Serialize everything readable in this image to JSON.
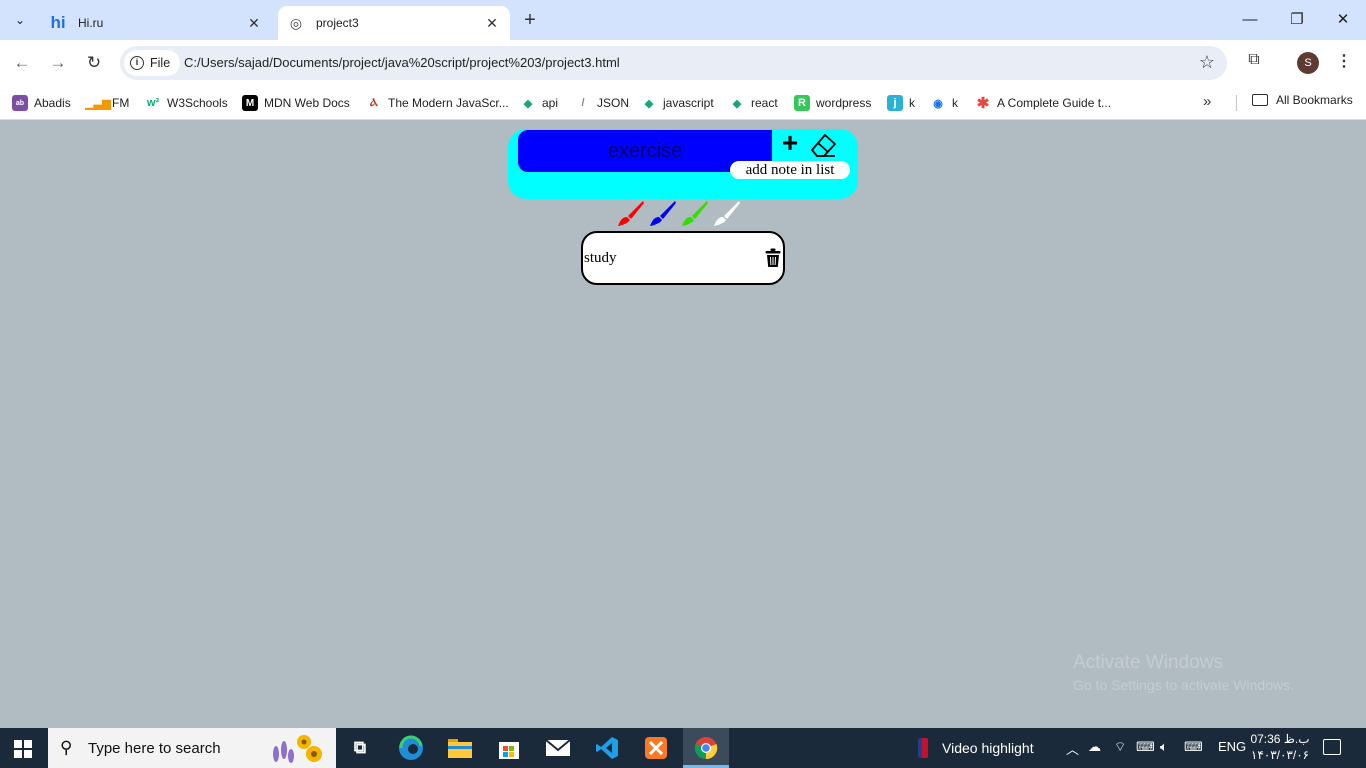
{
  "browser": {
    "tabs": [
      {
        "favicon": "hi",
        "title": "Hi.ru",
        "active": false
      },
      {
        "favicon": "globe-icon",
        "title": "project3",
        "active": true
      }
    ],
    "new_tab": "+",
    "address": {
      "chip_label": "File",
      "url": "C:/Users/sajad/Documents/project/java%20script/project%203/project3.html"
    },
    "profile_initial": "S",
    "bookmarks": [
      {
        "label": "Abadis",
        "icon": "abadis-icon",
        "color": "#7b4fa3"
      },
      {
        "label": "FM",
        "icon": "signal-bars-icon",
        "color": "#f29900"
      },
      {
        "label": "W3Schools",
        "icon": "w3schools-icon",
        "color": "#04aa6d"
      },
      {
        "label": "MDN Web Docs",
        "icon": "mdn-icon",
        "color": "#000000"
      },
      {
        "label": "The Modern JavaScr...",
        "icon": "javascript-info-icon",
        "color": "#c0392b"
      },
      {
        "label": "api",
        "icon": "vue-like-icon",
        "color": "#1aa679"
      },
      {
        "label": "JSON",
        "icon": "json-icon",
        "color": "#888888"
      },
      {
        "label": "javascript",
        "icon": "vue-like-icon",
        "color": "#1aa679"
      },
      {
        "label": "react",
        "icon": "vue-like-icon",
        "color": "#1aa679"
      },
      {
        "label": "wordpress",
        "icon": "r-icon",
        "color": "#34c759"
      },
      {
        "label": "k",
        "icon": "j-icon",
        "color": "#2bb0d6"
      },
      {
        "label": "k",
        "icon": "spiral-icon",
        "color": "#1a73e8"
      },
      {
        "label": "A Complete Guide t...",
        "icon": "asterisk-icon",
        "color": "#e8453c"
      }
    ],
    "all_bookmarks": "All Bookmarks"
  },
  "app": {
    "input_value": "exercise",
    "add_tooltip": "add note in list",
    "brush_colors": [
      "#ff0000",
      "#0000ff",
      "#33dd00",
      "#ffffff"
    ],
    "notes": [
      {
        "text": "study"
      }
    ]
  },
  "watermark": {
    "line1": "Activate Windows",
    "line2": "Go to Settings to activate Windows."
  },
  "taskbar": {
    "search_placeholder": "Type here to search",
    "video_highlight": "Video highlight",
    "language": "ENG",
    "time": "07:36 ب.ظ",
    "date": "۱۴۰۳/۰۳/۰۶"
  }
}
